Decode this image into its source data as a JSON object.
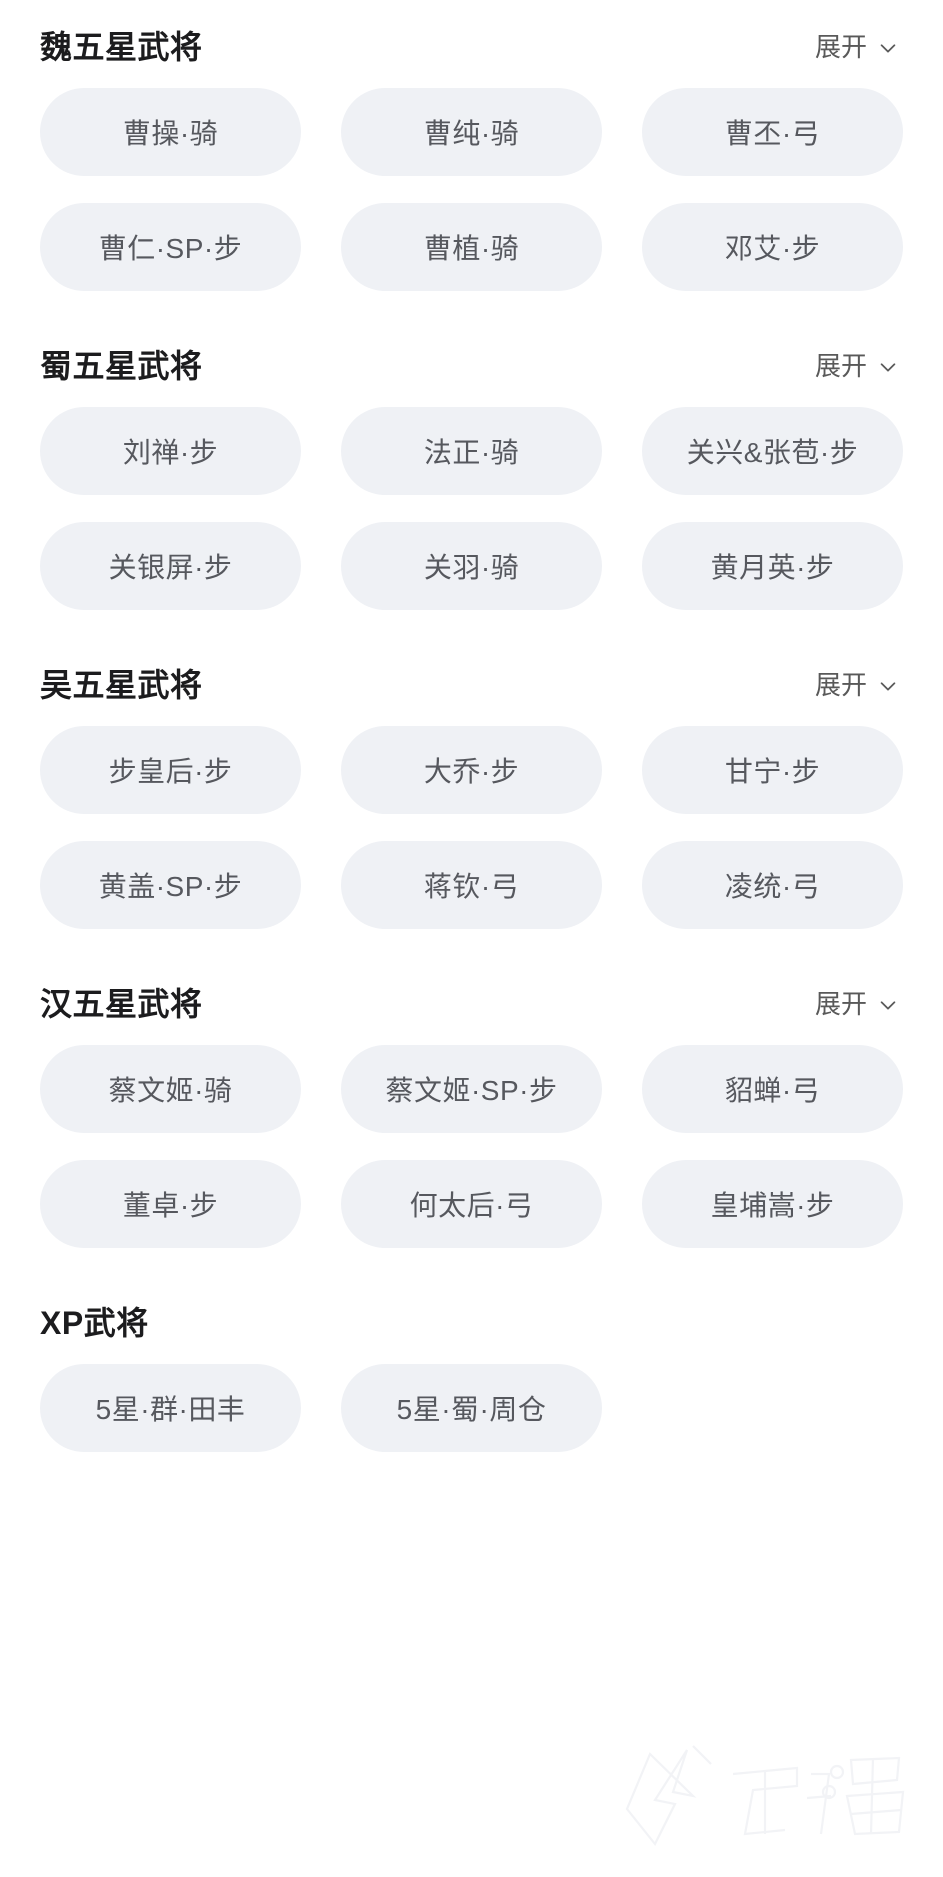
{
  "expand_label": "展开",
  "chevron_icon": "chevron-down-icon",
  "watermark": "九游",
  "colors": {
    "chip_bg": "#eff1f5",
    "chip_text": "#56585e",
    "title_text": "#1c1c1e",
    "link_text": "#595959",
    "page_bg": "#ffffff"
  },
  "sections": [
    {
      "title": "魏五星武将",
      "has_expand": true,
      "chips": [
        "曹操·骑",
        "曹纯·骑",
        "曹丕·弓",
        "曹仁·SP·步",
        "曹植·骑",
        "邓艾·步"
      ]
    },
    {
      "title": "蜀五星武将",
      "has_expand": true,
      "chips": [
        "刘禅·步",
        "法正·骑",
        "关兴&张苞·步",
        "关银屏·步",
        "关羽·骑",
        "黄月英·步"
      ]
    },
    {
      "title": "吴五星武将",
      "has_expand": true,
      "chips": [
        "步皇后·步",
        "大乔·步",
        "甘宁·步",
        "黄盖·SP·步",
        "蒋钦·弓",
        "凌统·弓"
      ]
    },
    {
      "title": "汉五星武将",
      "has_expand": true,
      "chips": [
        "蔡文姬·骑",
        "蔡文姬·SP·步",
        "貂蝉·弓",
        "董卓·步",
        "何太后·弓",
        "皇埔嵩·步"
      ]
    },
    {
      "title": "XP武将",
      "has_expand": false,
      "chips": [
        "5星·群·田丰",
        "5星·蜀·周仓"
      ]
    }
  ]
}
